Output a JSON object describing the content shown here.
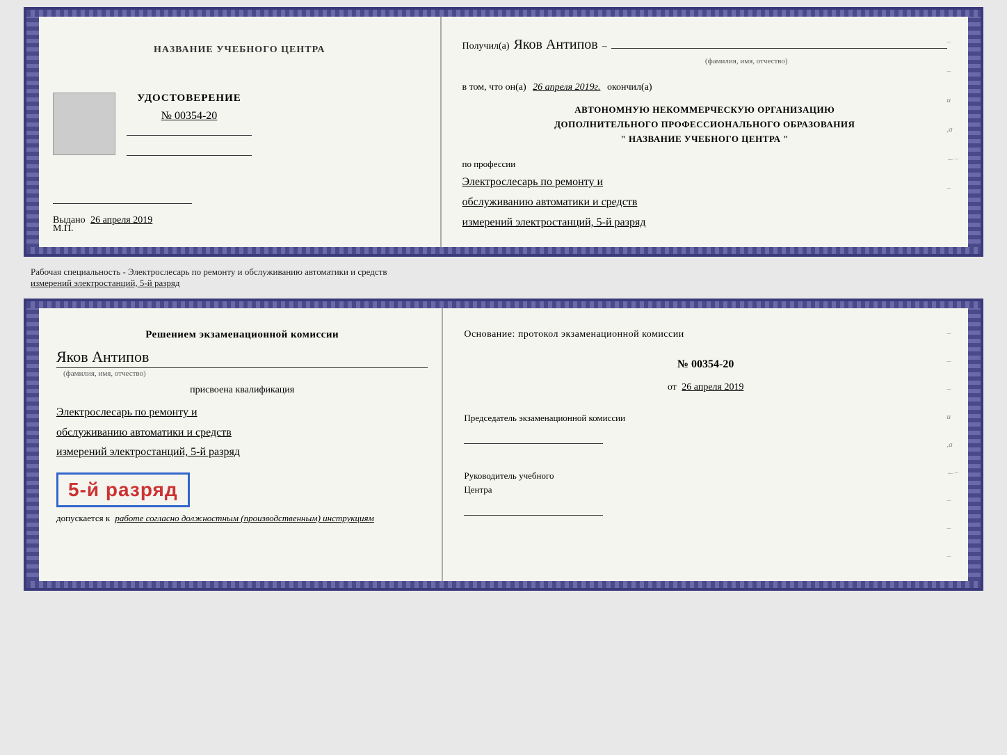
{
  "top_cert": {
    "left_page": {
      "center_title": "НАЗВАНИЕ УЧЕБНОГО ЦЕНТРА",
      "udostoverenie": "УДОСТОВЕРЕНИЕ",
      "number": "№ 00354-20",
      "issued_label": "Выдано",
      "issued_date": "26 апреля 2019",
      "mp_label": "М.П."
    },
    "right_page": {
      "received_label": "Получил(а)",
      "recipient_name": "Яков Антипов",
      "name_caption": "(фамилия, имя, отчество)",
      "dash": "–",
      "confirm_line_prefix": "в том, что он(а)",
      "confirm_date": "26 апреля 2019г.",
      "confirm_line_suffix": "окончил(а)",
      "org_line1": "АВТОНОМНУЮ НЕКОММЕРЧЕСКУЮ ОРГАНИЗАЦИЮ",
      "org_line2": "ДОПОЛНИТЕЛЬНОГО ПРОФЕССИОНАЛЬНОГО ОБРАЗОВАНИЯ",
      "org_line3": "\"   НАЗВАНИЕ УЧЕБНОГО ЦЕНТРА   \"",
      "profession_prefix": "по профессии",
      "profession_text": "Электрослесарь по ремонту и обслуживанию автоматики и средств измерений электростанций, 5-й разряд"
    }
  },
  "middle_label": {
    "text1": "Рабочая специальность - Электрослесарь по ремонту и обслуживанию автоматики и средств",
    "text2": "измерений электростанций, 5-й разряд"
  },
  "bottom_cert": {
    "left_page": {
      "decision_title": "Решением экзаменационной комиссии",
      "person_name": "Яков Антипов",
      "name_caption": "(фамилия, имя, отчество)",
      "assigned_label": "присвоена квалификация",
      "qualification_text": "Электрослесарь по ремонту и обслуживанию автоматики и средств измерений электростанций, 5-й разряд",
      "razryad_badge": "5-й разряд",
      "допускается_text": "допускается к",
      "допускается_italic": "работе согласно должностным (производственным) инструкциям"
    },
    "right_page": {
      "osnov_label": "Основание: протокол экзаменационной комиссии",
      "protocol_number": "№  00354-20",
      "date_prefix": "от",
      "date_value": "26 апреля 2019",
      "chairman_label": "Председатель экзаменационной комиссии",
      "director_label": "Руководитель учебного",
      "director_label2": "Центра"
    }
  }
}
